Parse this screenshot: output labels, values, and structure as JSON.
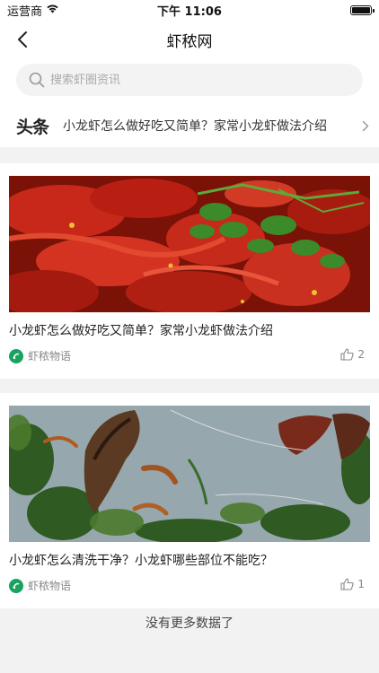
{
  "status": {
    "carrier": "运营商",
    "time": "下午 11:06"
  },
  "nav": {
    "title": "虾秾网"
  },
  "search": {
    "placeholder": "搜索虾圈资讯"
  },
  "headline": {
    "logo": "头条",
    "text": "小龙虾怎么做好吃又简单？家常小龙虾做法介绍"
  },
  "articles": [
    {
      "title": "小龙虾怎么做好吃又简单？家常小龙虾做法介绍",
      "author": "虾秾物语",
      "likes": "2"
    },
    {
      "title": "小龙虾怎么清洗干净？小龙虾哪些部位不能吃？",
      "author": "虾秾物语",
      "likes": "1"
    }
  ],
  "footer": {
    "text": "没有更多数据了"
  }
}
